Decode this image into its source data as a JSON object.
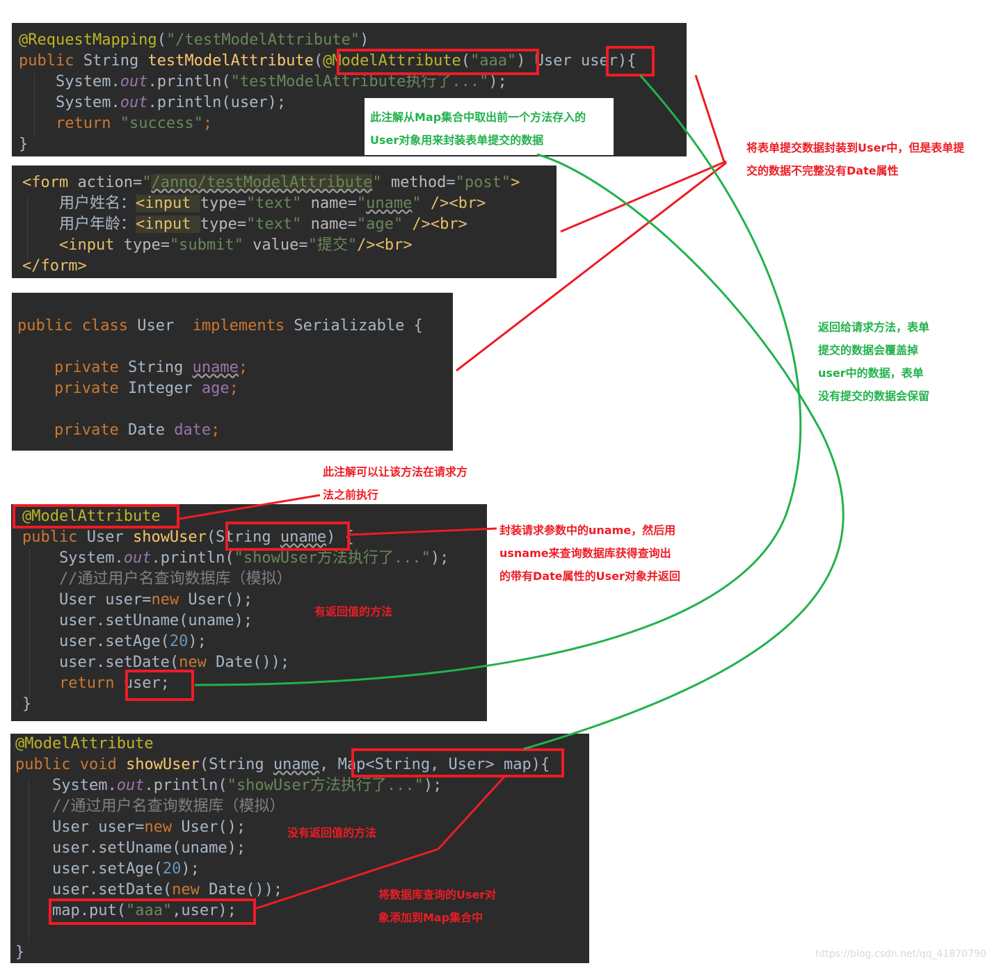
{
  "block1": {
    "line1": [
      "@RequestMapping",
      "(",
      "\"/testModelAttribute\"",
      ")"
    ],
    "line2": [
      "public ",
      "String ",
      "testModelAttribute",
      "(",
      "@ModelAttribute",
      "(",
      "\"aaa\"",
      ") User user){"
    ],
    "line3": [
      "    System.",
      "out",
      ".println(",
      "\"testModelAttribute执行了...\"",
      ");"
    ],
    "line4": [
      "    System.",
      "out",
      ".println(user);"
    ],
    "line5": [
      "    ",
      "return ",
      "\"success\"",
      ";"
    ],
    "line6": "}"
  },
  "block2": {
    "line1": [
      "<form ",
      "action",
      "=",
      "\"",
      "/anno/testModelAttribute",
      "\"",
      " method",
      "=",
      "\"post\"",
      ">"
    ],
    "line2": [
      "    用户姓名：",
      "<input ",
      "type",
      "=",
      "\"text\"",
      " name",
      "=",
      "\"",
      "uname",
      "\"",
      " />",
      "<br>"
    ],
    "line3": [
      "    用户年龄：",
      "<input ",
      "type",
      "=",
      "\"text\"",
      " name",
      "=",
      "\"age\"",
      " />",
      "<br>"
    ],
    "line4": [
      "    ",
      "<input ",
      "type",
      "=",
      "\"submit\"",
      " value",
      "=",
      "\"提交\"",
      "/>",
      "<br>"
    ],
    "line5": "</form>"
  },
  "block3": {
    "line1": [
      "public ",
      "class ",
      "User  ",
      "implements ",
      "Serializable {"
    ],
    "line2": [
      "    ",
      "private ",
      "String ",
      "uname",
      ";"
    ],
    "line3": [
      "    ",
      "private ",
      "Integer ",
      "age",
      ";"
    ],
    "line4": [
      "    ",
      "private ",
      "Date ",
      "date",
      ";"
    ]
  },
  "block4": {
    "line1": "@ModelAttribute",
    "line2": [
      "public ",
      "User ",
      "showUser",
      "(String ",
      "uname",
      ") {"
    ],
    "line3": [
      "    System.",
      "out",
      ".println(",
      "\"showUser方法执行了...\"",
      ");"
    ],
    "line4": "    //通过用户名查询数据库（模拟）",
    "line5": [
      "    User user=",
      "new ",
      "User();"
    ],
    "line6": [
      "    user.setUname(uname);"
    ],
    "line7": [
      "    user.setAge(",
      "20",
      ");"
    ],
    "line8": [
      "    user.setDate(",
      "new ",
      "Date());"
    ],
    "line9": [
      "    ",
      "return ",
      "user;"
    ],
    "line10": "}"
  },
  "block5": {
    "line1": "@ModelAttribute",
    "line2": [
      "public ",
      "void ",
      "showUser",
      "(String ",
      "uname",
      ", Map<String, User> map){"
    ],
    "line3": [
      "    System.",
      "out",
      ".println(",
      "\"showUser方法执行了...\"",
      ");"
    ],
    "line4": "    //通过用户名查询数据库（模拟）",
    "line5": [
      "    User user=",
      "new ",
      "User();"
    ],
    "line6": "    user.setUname(uname);",
    "line7": [
      "    user.setAge(",
      "20",
      ");"
    ],
    "line8": [
      "    user.setDate(",
      "new ",
      "Date());"
    ],
    "line9": [
      "    map.put(",
      "\"aaa\"",
      ",user);"
    ],
    "line10": "}"
  },
  "notes": {
    "green_box": "此注解从Map集合中取出前一个方法存入的\nUser对象用来封装表单提交的数据",
    "red_form": "将表单提交数据封装到User中，但是表单提\n交的数据不完整没有Date属性",
    "green_return": "返回给请求方法，表单\n提交的数据会覆盖掉\nuser中的数据，表单\n没有提交的数据会保留",
    "red_annot": "此注解可以让该方法在请求方\n法之前执行",
    "red_uname": "封装请求参数中的uname，然后用\nusname来查询数据库获得查询出\n的带有Date属性的User对象并返回",
    "red_has_return": "有返回值的方法",
    "red_no_return": "没有返回值的方法",
    "red_map": "将数据库查询的User对\n象添加到Map集合中"
  },
  "watermark": "https://blog.csdn.net/qq_41870790",
  "colors": {
    "code_bg": "#2b2b2b",
    "red": "#ee1c25",
    "green": "#22b14c"
  }
}
